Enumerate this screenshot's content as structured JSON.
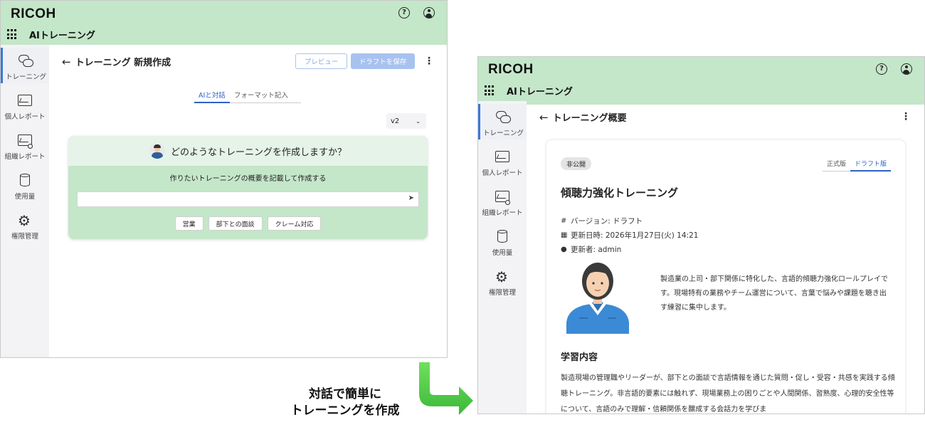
{
  "brand": {
    "logo": "RICOH",
    "app_title": "AIトレーニング",
    "accent": "#2d62c4",
    "header_bg": "#c4e6c9"
  },
  "topbar": {
    "help_glyph": "?"
  },
  "sidebar": {
    "items": [
      {
        "label": "トレーニング",
        "icon": "chat-bubbles-icon",
        "active": true
      },
      {
        "label": "個人レポート",
        "icon": "report-icon"
      },
      {
        "label": "組織レポート",
        "icon": "org-report-icon"
      },
      {
        "label": "使用量",
        "icon": "database-icon"
      },
      {
        "label": "権限管理",
        "icon": "gear-icon"
      }
    ]
  },
  "create_screen": {
    "back_glyph": "←",
    "title": "トレーニング 新規作成",
    "preview_button": "プレビュー",
    "save_draft_button": "ドラフトを保存",
    "tabs": [
      "AIと対話",
      "フォーマット記入"
    ],
    "active_tab": 0,
    "version_select": "v2",
    "ai_card": {
      "question": "どのようなトレーニングを作成しますか？",
      "description": "作りたいトレーニングの概要を記載して作成する",
      "input_value": "",
      "send_glyph": "➤",
      "chips": [
        "営業",
        "部下との面談",
        "クレーム対応"
      ]
    }
  },
  "caption": {
    "line1": "対話で簡単に",
    "line2": "トレーニングを作成"
  },
  "summary_screen": {
    "back_glyph": "←",
    "title": "トレーニング概要",
    "card": {
      "badge": "非公開",
      "tabs": [
        "正式版",
        "ドラフト版"
      ],
      "active_tab": 1,
      "title": "傾聴力強化トレーニング",
      "meta": {
        "version": "バージョン: ドラフト",
        "updated_at": "更新日時: 2026年1月27日(火) 14:21",
        "updated_by": "更新者: admin"
      },
      "description": "製造業の上司・部下関係に特化した、言語的傾聴力強化ロールプレイです。現場特有の業務やチーム運営について、言葉で悩みや課題を聴き出す練習に集中します。",
      "section_title": "学習内容",
      "section_body": "製造現場の管理職やリーダーが、部下との面談で言語情報を通じた質問・促し・受容・共感を実践する傾聴トレーニング。非言語的要素には触れず、現場業務上の困りごとや人間関係、習熟度、心理的安全性等について、言語のみで理解・信頼関係を醸成する会話力を学びま"
    }
  }
}
